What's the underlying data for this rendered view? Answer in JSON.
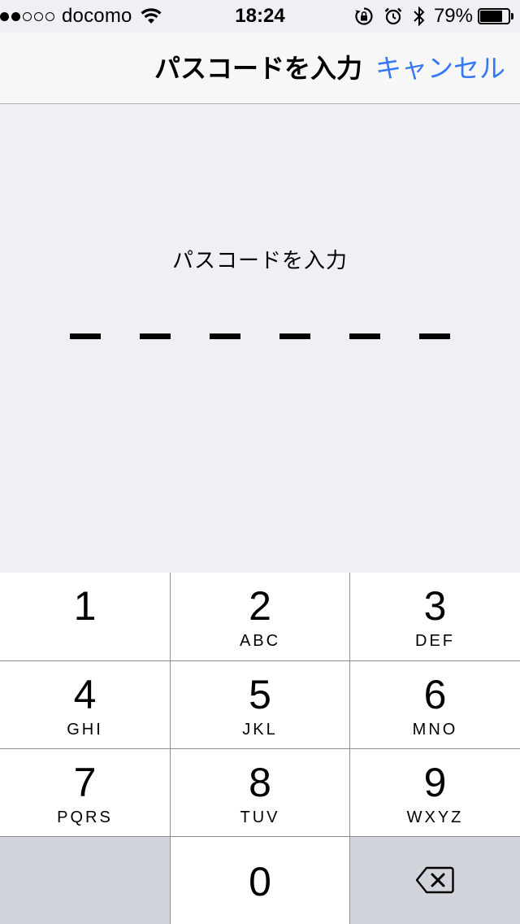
{
  "status_bar": {
    "signal_filled": 2,
    "signal_total": 5,
    "carrier": "docomo",
    "time": "18:24",
    "battery_percent_label": "79%",
    "battery_level": 0.79,
    "icons": [
      "wifi-icon",
      "rotation-lock-icon",
      "alarm-icon",
      "bluetooth-icon",
      "battery-icon"
    ]
  },
  "nav": {
    "title": "パスコードを入力",
    "cancel_label": "キャンセル"
  },
  "passcode": {
    "prompt": "パスコードを入力",
    "length": 6,
    "entered": 0
  },
  "keypad": {
    "keys": [
      {
        "digit": "1",
        "letters": ""
      },
      {
        "digit": "2",
        "letters": "ABC"
      },
      {
        "digit": "3",
        "letters": "DEF"
      },
      {
        "digit": "4",
        "letters": "GHI"
      },
      {
        "digit": "5",
        "letters": "JKL"
      },
      {
        "digit": "6",
        "letters": "MNO"
      },
      {
        "digit": "7",
        "letters": "PQRS"
      },
      {
        "digit": "8",
        "letters": "TUV"
      },
      {
        "digit": "9",
        "letters": "WXYZ"
      },
      {
        "digit": "0",
        "letters": ""
      }
    ],
    "backspace_icon": "backspace-icon"
  },
  "colors": {
    "background": "#efeff4",
    "nav_background": "#f7f7f7",
    "accent": "#3478f6",
    "keypad_gray": "#d1d5db",
    "key_white": "#ffffff",
    "divider": "#8e8e93"
  }
}
